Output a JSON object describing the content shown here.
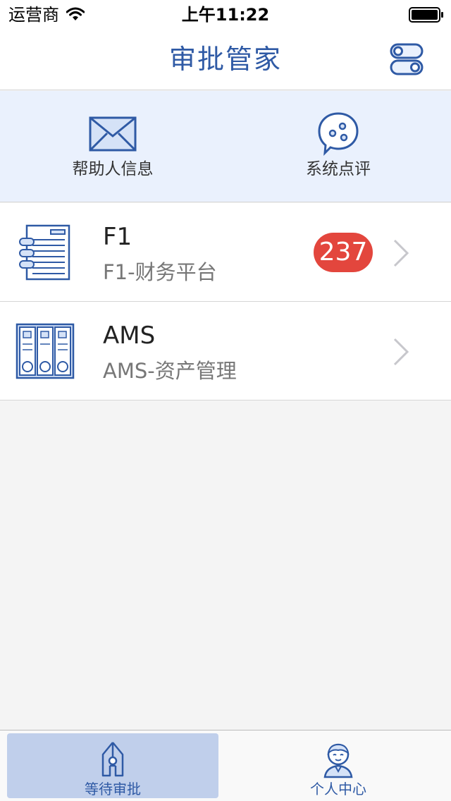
{
  "status_bar": {
    "carrier": "运营商",
    "time": "上午11:22"
  },
  "nav": {
    "title": "审批管家",
    "settings_icon": "toggle-switches-icon"
  },
  "quick_actions": [
    {
      "label": "帮助人信息",
      "icon": "envelope-icon"
    },
    {
      "label": "系统点评",
      "icon": "comment-bubble-icon"
    }
  ],
  "systems": [
    {
      "name": "F1",
      "description": "F1-财务平台",
      "badge": "237",
      "icon": "document-binder-icon"
    },
    {
      "name": "AMS",
      "description": "AMS-资产管理",
      "badge": "",
      "icon": "file-cabinet-icon"
    }
  ],
  "tabs": [
    {
      "label": "等待审批",
      "icon": "pen-nib-icon",
      "active": true
    },
    {
      "label": "个人中心",
      "icon": "user-avatar-icon",
      "active": false
    }
  ],
  "colors": {
    "accent": "#2f5aa5",
    "badge": "#e3463d",
    "quick_actions_bg": "#eaf1fd",
    "active_tab_bg": "#c0cfeb"
  }
}
